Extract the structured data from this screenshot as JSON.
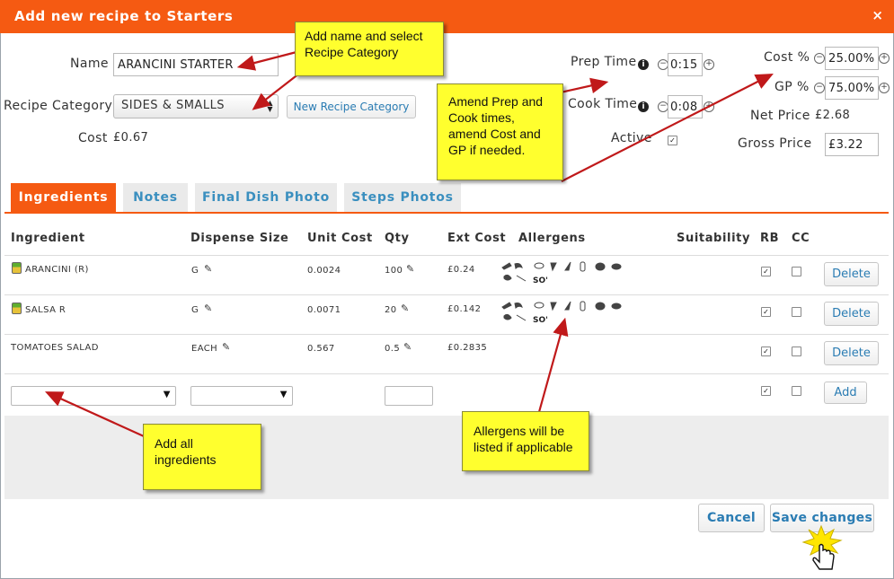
{
  "dialog": {
    "title": "Add new recipe to Starters",
    "close": "×"
  },
  "form": {
    "name_label": "Name",
    "name_value": "ARANCINI STARTER",
    "category_label": "Recipe Category",
    "category_value": "SIDES & SMALLS",
    "new_category_button": "New Recipe Category",
    "cost_label": "Cost",
    "cost_value": "£0.67",
    "prep_label": "Prep Time",
    "prep_value": "0:15",
    "cook_label": "Cook Time",
    "cook_value": "0:08",
    "active_label": "Active",
    "cost_pct_label": "Cost %",
    "cost_pct_value": "25.00%",
    "gp_pct_label": "GP %",
    "gp_pct_value": "75.00%",
    "net_price_label": "Net Price",
    "net_price_value": "£2.68",
    "gross_price_label": "Gross Price",
    "gross_price_value": "£3.22"
  },
  "tabs": [
    "Ingredients",
    "Notes",
    "Final Dish Photo",
    "Steps Photos"
  ],
  "table": {
    "headers": [
      "Ingredient",
      "Dispense Size",
      "Unit Cost",
      "Qty",
      "Ext Cost",
      "Allergens",
      "Suitability",
      "RB",
      "CC"
    ],
    "rows": [
      {
        "ingredient": "ARANCINI (R)",
        "dispense": "G",
        "unit_cost": "0.0024",
        "qty": "100",
        "ext_cost": "£0.24",
        "delete": "Delete"
      },
      {
        "ingredient": "SALSA R",
        "dispense": "G",
        "unit_cost": "0.0071",
        "qty": "20",
        "ext_cost": "£0.142",
        "delete": "Delete"
      },
      {
        "ingredient": "TOMATOES SALAD",
        "dispense": "EACH",
        "unit_cost": "0.567",
        "qty": "0.5",
        "ext_cost": "£0.2835",
        "delete": "Delete"
      }
    ],
    "add_button": "Add"
  },
  "footer": {
    "cancel": "Cancel",
    "save": "Save changes"
  },
  "notes": {
    "name_note": "Add name and select Recipe Category",
    "times_note": "Amend Prep and Cook times, amend Cost and GP if needed.",
    "ingredients_note": "Add all ingredients",
    "allergens_note": "Allergens will be listed if applicable"
  },
  "colors": {
    "accent": "#f55a12",
    "link": "#2a7cb3",
    "note": "#ffff2e",
    "arrow": "#c0191a"
  }
}
